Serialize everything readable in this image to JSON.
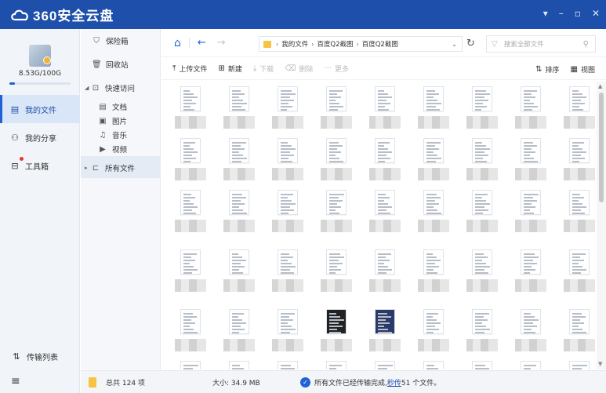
{
  "app": {
    "title": "360安全云盘"
  },
  "window_controls": {
    "dropdown": "▾",
    "minimize": "–",
    "maximize": "▫",
    "close": "✕"
  },
  "account": {
    "storage": "8.53G/100G",
    "used_fraction": 0.085
  },
  "leftnav": {
    "items": [
      {
        "label": "我的文件",
        "icon": "file-list-icon"
      },
      {
        "label": "我的分享",
        "icon": "share-icon"
      },
      {
        "label": "工具箱",
        "icon": "toolbox-icon"
      }
    ],
    "transfer_label": "传输列表",
    "menu_glyph": "≡"
  },
  "tree": {
    "safe_box": "保险箱",
    "recycle_bin": "回收站",
    "quick_access": "快速访问",
    "documents": "文档",
    "pictures": "图片",
    "music": "音乐",
    "videos": "视频",
    "all_files": "所有文件"
  },
  "address": {
    "crumbs": [
      "我的文件",
      "百度Q2截图",
      "百度Q2截图"
    ],
    "search_placeholder": "搜索全部文件"
  },
  "toolbar": {
    "upload": "上传文件",
    "new": "新建",
    "download": "下载",
    "delete": "删除",
    "more": "更多",
    "sort": "排序",
    "view": "视图"
  },
  "status": {
    "total": "总共 124 项",
    "size": "大小: 34.9 MB",
    "message": "所有文件已经传输完成,",
    "link": "秒传",
    "message_tail": "51 个文件。"
  }
}
